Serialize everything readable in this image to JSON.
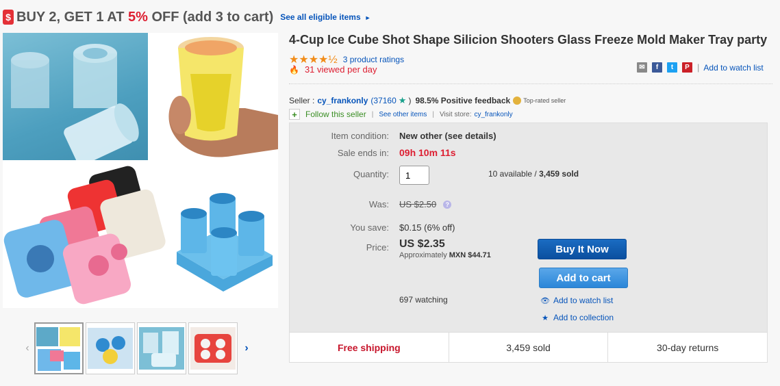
{
  "promo": {
    "tag_icon": "$",
    "text_before": "BUY 2, GET 1 AT ",
    "percent": "5%",
    "text_after": " OFF (add 3 to cart)",
    "link": "See all eligible items",
    "link_arrow": "►"
  },
  "thumbs": {
    "prev": "‹",
    "next": "›"
  },
  "item": {
    "title": "4-Cup Ice Cube Shot Shape Silicion Shooters Glass Freeze Mold Maker Tray party",
    "stars": "★★★★½",
    "rating_value": 4.5,
    "ratings_link": "3 product ratings",
    "viewed_icon": "🔥",
    "viewed": "31 viewed per day",
    "share_sep": "|",
    "watch_link": "Add to watch list"
  },
  "seller": {
    "label": "Seller :",
    "name": "cy_frankonly",
    "score": "(37160",
    "score_close": ")",
    "star_icon": "★",
    "feedback": "98.5% Positive feedback",
    "top_rated": "Top-rated seller",
    "follow": "Follow this seller",
    "sep": "|",
    "see_other": "See other items",
    "visit_label": "Visit store:",
    "store": "cy_frankonly"
  },
  "details": {
    "condition_label": "Item condition:",
    "condition": "New other (see details)",
    "sale_label": "Sale ends in:",
    "sale": "09h 10m 11s",
    "qty_label": "Quantity:",
    "qty": "1",
    "available": "10 available / ",
    "sold_count": "3,459 sold",
    "was_label": "Was:",
    "was": "US $2.50",
    "help_icon": "?",
    "save_label": "You save:",
    "save": "$0.15 (6% off)",
    "price_label": "Price:",
    "price": "US $2.35",
    "approx_label": "Approximately ",
    "approx": "MXN $44.71",
    "buy_now": "Buy It Now",
    "add_to_cart": "Add to cart",
    "watching": "697 watching",
    "watch_icon": "👁",
    "watch_link": "Add to watch list",
    "collection_icon": "★",
    "collection_link": "Add to collection"
  },
  "footer": {
    "shipping": "Free shipping",
    "sold": "3,459 sold",
    "returns": "30-day returns"
  },
  "colors": {
    "accent_red": "#dd1e31",
    "link_blue": "#0654ba",
    "buy_blue": "#0b4f9f",
    "cart_blue": "#2b86d8",
    "star_orange": "#f18c19"
  }
}
